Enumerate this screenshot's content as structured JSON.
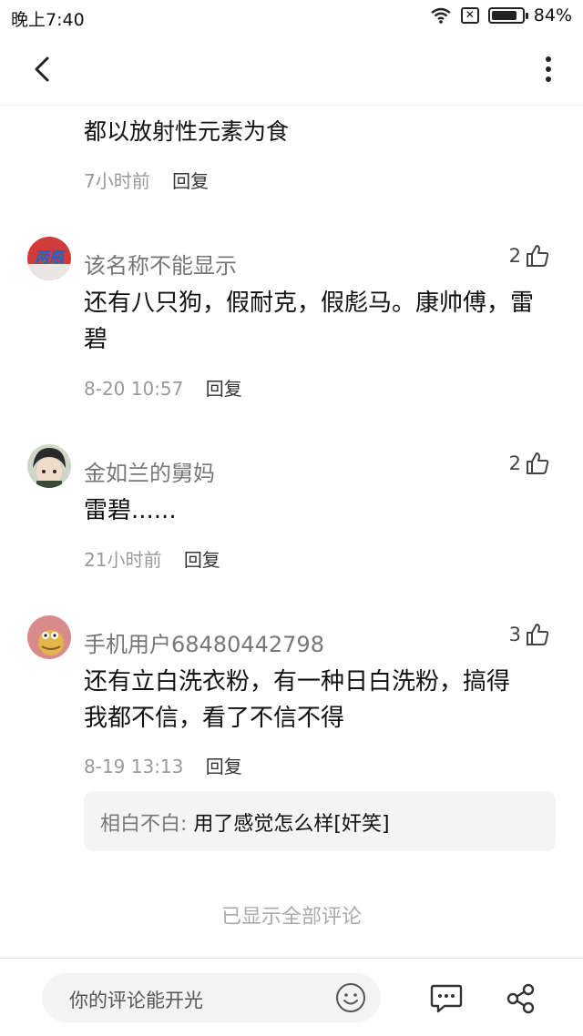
{
  "status_bar": {
    "time": "晚上7:40",
    "battery": "84%",
    "battery_level": 0.84
  },
  "feed": {
    "clipped_comment": {
      "top_line_partial": "…………………………………",
      "last_line": "都以放射性元素为食",
      "time": "7小时前",
      "reply_label": "回复"
    },
    "comments": [
      {
        "username": "该名称不能显示",
        "likes": "2",
        "text_lines": [
          "还有八只狗，假耐克，假彪马。康帅傅，雷",
          "碧"
        ],
        "time": "8-20 10:57",
        "reply_label": "回复",
        "avatar_icon": "avatar-red-logo"
      },
      {
        "username": "金如兰的舅妈",
        "likes": "2",
        "text_lines": [
          "雷碧......"
        ],
        "time": "21小时前",
        "reply_label": "回复",
        "avatar_icon": "avatar-anime-character"
      },
      {
        "username": "手机用户68480442798",
        "likes": "3",
        "text_lines": [
          "还有立白洗衣粉，有一种日白洗粉，搞得",
          "我都不信，看了不信不得"
        ],
        "time": "8-19 13:13",
        "reply_label": "回复",
        "avatar_icon": "avatar-cartoon-creature",
        "sub_reply": {
          "user": "相白不白:",
          "text": "用了感觉怎么样[奸笑]"
        }
      }
    ],
    "all_shown": "已显示全部评论"
  },
  "bottom_bar": {
    "input_placeholder": "你的评论能开光"
  }
}
